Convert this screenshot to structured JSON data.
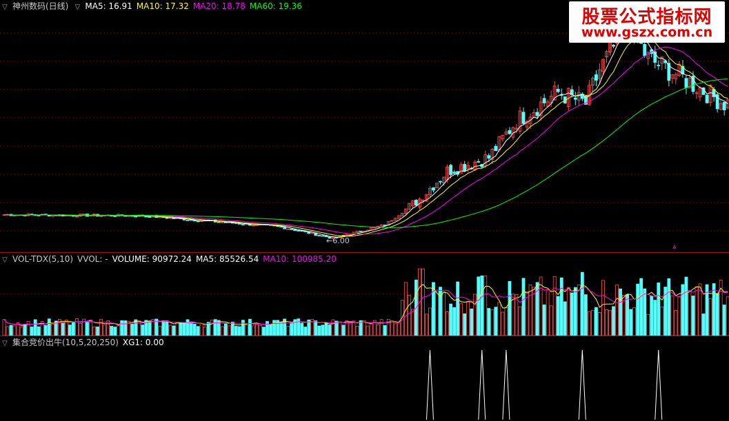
{
  "main_panel": {
    "stock_name": "神州数码(日线)",
    "ma5": "MA5: 16.91",
    "ma10": "MA10: 17.32",
    "ma20": "MA20: 18.78",
    "ma60": "MA60: 19.36",
    "low_price_label": "6.00",
    "colors": {
      "ma5": "#ffffff",
      "ma10": "#ffff00",
      "ma20": "#ff00ff",
      "ma60": "#00ff00",
      "up": "#ff5050",
      "down": "#54fcfc"
    }
  },
  "volume_panel": {
    "indicator": "VOL-TDX(5,10)",
    "vvol": "VVOL: -",
    "volume": "VOLUME: 90972.24",
    "ma5": "MA5: 85526.54",
    "ma10": "MA10: 100985.20"
  },
  "indicator_panel": {
    "name": "集合竞价出牛(10,5,20,250)",
    "xg1": "XG1: 0.00"
  },
  "watermark": {
    "title": "股票公式指标网",
    "url": "www.gszx.com.cn"
  },
  "chart_data": {
    "type": "candlestick",
    "ohlc_anchors_close": [
      [
        0,
        8.1
      ],
      [
        40,
        8.0
      ],
      [
        80,
        7.0
      ],
      [
        95,
        6.0
      ],
      [
        110,
        7.2
      ],
      [
        120,
        9.5
      ],
      [
        128,
        12.0
      ],
      [
        140,
        13.2
      ],
      [
        148,
        16.5
      ],
      [
        160,
        19.0
      ],
      [
        168,
        18.0
      ],
      [
        172,
        21.0
      ],
      [
        180,
        25.0
      ],
      [
        186,
        22.0
      ],
      [
        195,
        20.5
      ],
      [
        208,
        18.0
      ]
    ],
    "signal_bars": [
      123,
      138,
      145,
      167,
      189
    ],
    "bar_count": 210,
    "price_range": [
      5.0,
      26.0
    ],
    "min_price": 6.0
  }
}
